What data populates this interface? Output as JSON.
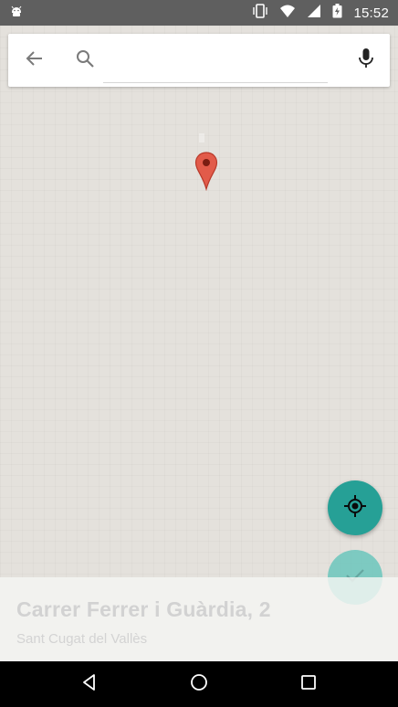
{
  "status_bar": {
    "time": "15:52",
    "icons": [
      "android-debug-icon",
      "vibrate-icon",
      "wifi-icon",
      "signal-icon",
      "battery-charging-icon"
    ]
  },
  "search": {
    "value": "",
    "placeholder": "",
    "icons": [
      "back-arrow-icon",
      "search-icon",
      "mic-icon"
    ]
  },
  "map": {
    "marker_icon": "map-pin-icon",
    "marker_color": "#dd4b39"
  },
  "fabs": {
    "location_icon": "my-location-icon",
    "confirm_icon": "check-icon",
    "accent": "#26a096"
  },
  "address": {
    "title": "Carrer Ferrer i Guàrdia, 2",
    "subtitle": "Sant Cugat del Vallès"
  },
  "nav_bar": {
    "icons": [
      "back-triangle-icon",
      "home-circle-icon",
      "recents-square-icon"
    ]
  }
}
